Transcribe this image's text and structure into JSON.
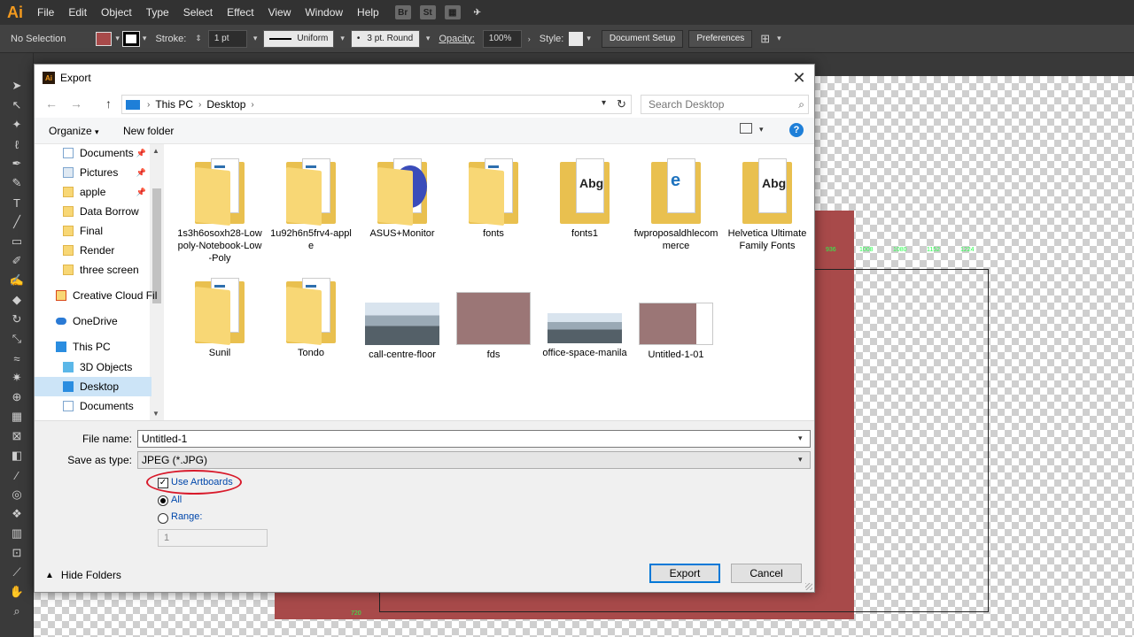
{
  "app": {
    "logo": "Ai",
    "menu": [
      "File",
      "Edit",
      "Object",
      "Type",
      "Select",
      "Effect",
      "View",
      "Window",
      "Help"
    ],
    "bridge_icon": "Br",
    "stock_icon": "St"
  },
  "controlbar": {
    "selection": "No Selection",
    "stroke_label": "Stroke:",
    "stroke_value": "1 pt",
    "profile_label": "Uniform",
    "brush_label": "3 pt. Round",
    "opacity_label": "Opacity:",
    "opacity_value": "100%",
    "style_label": "Style:",
    "doc_setup": "Document Setup",
    "preferences": "Preferences",
    "fill_color": "#a84a4a"
  },
  "canvas": {
    "ruler_labels": [
      "936",
      "1008",
      "1080",
      "1152",
      "1224"
    ],
    "ruler_720": "720"
  },
  "dialog": {
    "title": "Export",
    "breadcrumb": [
      "This PC",
      "Desktop"
    ],
    "search_placeholder": "Search Desktop",
    "organize": "Organize",
    "new_folder": "New folder",
    "help": "?",
    "nav_items": [
      {
        "label": "Documents",
        "icon": "doc-icon",
        "pinned": true
      },
      {
        "label": "Pictures",
        "icon": "picture-icon",
        "pinned": true
      },
      {
        "label": "apple",
        "icon": "folder-icon",
        "pinned": true
      },
      {
        "label": "Data Borrow",
        "icon": "folder-icon",
        "pinned": false
      },
      {
        "label": "Final",
        "icon": "folder-icon",
        "pinned": false
      },
      {
        "label": "Render",
        "icon": "folder-icon",
        "pinned": false
      },
      {
        "label": "three screen",
        "icon": "folder-icon",
        "pinned": false
      },
      {
        "label": "Creative Cloud Fil",
        "icon": "creative-cloud-icon",
        "pinned": false
      },
      {
        "label": "OneDrive",
        "icon": "onedrive-icon",
        "pinned": false
      },
      {
        "label": "This PC",
        "icon": "pc-icon",
        "pinned": false
      },
      {
        "label": "3D Objects",
        "icon": "3d-objects-icon",
        "pinned": false
      },
      {
        "label": "Desktop",
        "icon": "desktop-icon",
        "pinned": false
      },
      {
        "label": "Documents",
        "icon": "doc-icon",
        "pinned": false
      }
    ],
    "files": [
      {
        "name": "1s3h6osoxh28-Lowpoly-Notebook-Low-Poly",
        "kind": "folder-doc"
      },
      {
        "name": "1u92h6n5frv4-apple",
        "kind": "folder-doc"
      },
      {
        "name": "ASUS+Monitor",
        "kind": "folder-disc"
      },
      {
        "name": "fonts",
        "kind": "folder-doc"
      },
      {
        "name": "fonts1",
        "kind": "folder-font"
      },
      {
        "name": "fwproposaldhlecommerce",
        "kind": "folder-pdf"
      },
      {
        "name": "Helvetica Ultimate Family Fonts",
        "kind": "folder-font"
      },
      {
        "name": "Sunil",
        "kind": "folder-doc"
      },
      {
        "name": "Tondo",
        "kind": "folder-doc"
      },
      {
        "name": "call-centre-floor",
        "kind": "photo-office"
      },
      {
        "name": "fds",
        "kind": "photo-pink"
      },
      {
        "name": "office-space-manila",
        "kind": "photo-office"
      },
      {
        "name": "Untitled-1-01",
        "kind": "photo-pink-white"
      }
    ],
    "filename_label": "File name:",
    "filename_value": "Untitled-1",
    "savetype_label": "Save as type:",
    "savetype_value": "JPEG (*.JPG)",
    "use_artboards": "Use Artboards",
    "use_artboards_checked": true,
    "all_label": "All",
    "range_label": "Range:",
    "range_value": "1",
    "range_selected": false,
    "hide_folders": "Hide Folders",
    "export_btn": "Export",
    "cancel_btn": "Cancel"
  }
}
